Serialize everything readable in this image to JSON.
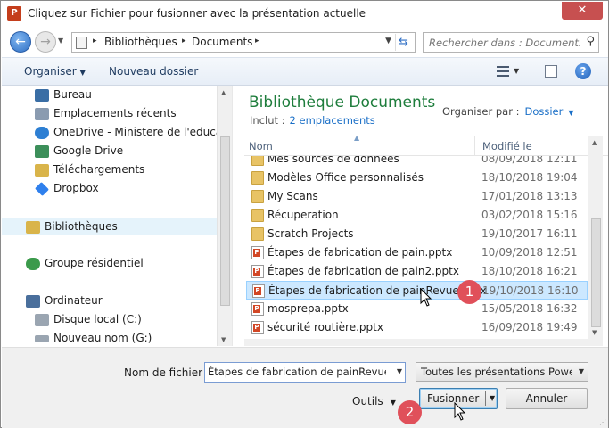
{
  "window": {
    "title": "Cliquez sur Fichier pour fusionner avec la présentation actuelle",
    "close_glyph": "✕",
    "app_icon_letter": "P"
  },
  "address": {
    "crumbs": [
      "Bibliothèques",
      "Documents"
    ],
    "separator": "▸"
  },
  "search": {
    "placeholder": "Rechercher dans : Documents"
  },
  "toolbar": {
    "organize": "Organiser",
    "new_folder": "Nouveau dossier",
    "help": "?"
  },
  "nav": {
    "items": [
      {
        "label": "Bureau",
        "icon": "desktop-icon",
        "color": "#3a6ea5"
      },
      {
        "label": "Emplacements récents",
        "icon": "recent-places-icon",
        "color": "#8a9bb0"
      },
      {
        "label": "OneDrive - Ministere de l'education",
        "icon": "onedrive-icon",
        "color": "#2d7fd3"
      },
      {
        "label": "Google Drive",
        "icon": "google-drive-icon",
        "color": "#3c8f5a"
      },
      {
        "label": "Téléchargements",
        "icon": "downloads-icon",
        "color": "#d9b44a"
      },
      {
        "label": "Dropbox",
        "icon": "dropbox-icon",
        "color": "#2f80ed"
      },
      {
        "label": "Bibliothèques",
        "icon": "libraries-icon",
        "color": "#d9b44a"
      },
      {
        "label": "Groupe résidentiel",
        "icon": "homegroup-icon",
        "color": "#3b9a4b"
      },
      {
        "label": "Ordinateur",
        "icon": "computer-icon",
        "color": "#4a6f9c"
      },
      {
        "label": "Disque local (C:)",
        "icon": "local-disk-icon",
        "color": "#9aa5b1"
      },
      {
        "label": "Nouveau nom (G:)",
        "icon": "drive-icon",
        "color": "#9aa5b1"
      }
    ]
  },
  "library": {
    "title": "Bibliothèque Documents",
    "includes_label": "Inclut :",
    "includes_link": "2 emplacements",
    "arrange_label": "Organiser par :",
    "arrange_value": "Dossier"
  },
  "columns": {
    "name": "Nom",
    "modified": "Modifié le"
  },
  "files": [
    {
      "name": "Mes sources de données",
      "date": "08/09/2018 12:11",
      "type": "folder"
    },
    {
      "name": "Modèles Office personnalisés",
      "date": "18/10/2018 19:04",
      "type": "folder"
    },
    {
      "name": "My Scans",
      "date": "17/01/2018 13:13",
      "type": "folder"
    },
    {
      "name": "Récuperation",
      "date": "03/02/2018 15:16",
      "type": "folder"
    },
    {
      "name": "Scratch Projects",
      "date": "19/10/2017 16:11",
      "type": "folder"
    },
    {
      "name": "Étapes de fabrication de pain.pptx",
      "date": "10/09/2018 12:51",
      "type": "pptx"
    },
    {
      "name": "Étapes de fabrication de pain2.pptx",
      "date": "18/10/2018 16:21",
      "type": "pptx"
    },
    {
      "name": "Étapes de fabrication de painRevue.pptx",
      "date": "19/10/2018 16:10",
      "type": "pptx",
      "selected": true
    },
    {
      "name": "mosprepa.pptx",
      "date": "15/05/2018 16:32",
      "type": "pptx"
    },
    {
      "name": "sécurité routière.pptx",
      "date": "16/09/2018 19:49",
      "type": "pptx"
    }
  ],
  "bottom": {
    "filename_label": "Nom de fichier :",
    "filename_value": "Étapes de fabrication de painRevue.ppt",
    "filetype_value": "Toutes les présentations PowerP",
    "tools_label": "Outils",
    "merge_label": "Fusionner",
    "cancel_label": "Annuler"
  },
  "annotations": {
    "step1": "1",
    "step2": "2",
    "badge_color": "#e0505a"
  },
  "colors": {
    "library_title": "#1e7d3c",
    "link": "#1a6fc7",
    "selection": "#cce8ff"
  }
}
